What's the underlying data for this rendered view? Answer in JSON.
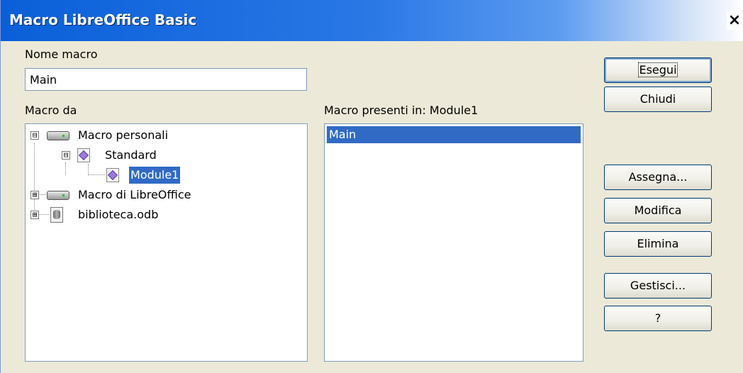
{
  "window": {
    "title": "Macro LibreOffice Basic",
    "close_label": "×"
  },
  "macro_name": {
    "label": "Nome macro",
    "value": "Main"
  },
  "macro_from": {
    "label": "Macro da",
    "tree": [
      {
        "label": "Macro personali",
        "icon": "drive-icon",
        "expander": "⊟"
      },
      {
        "label": "Standard",
        "icon": "library-icon",
        "expander": "⊟"
      },
      {
        "label": "Module1",
        "icon": "module-icon",
        "selected": true
      },
      {
        "label": "Macro di LibreOffice",
        "icon": "drive-icon",
        "expander": "⊞"
      },
      {
        "label": "biblioteca.odb",
        "icon": "database-icon",
        "expander": "⊞"
      }
    ]
  },
  "existing_macros": {
    "label": "Macro presenti in: Module1",
    "items": [
      "Main"
    ]
  },
  "buttons": {
    "run": "Esegui",
    "close": "Chiudi",
    "assign": "Assegna...",
    "edit": "Modifica",
    "delete": "Elimina",
    "organize": "Gestisci...",
    "help": "?"
  },
  "colors": {
    "selection": "#316ac5",
    "titlebar": "#0a5fd8",
    "dialog_bg": "#ece9d8"
  }
}
